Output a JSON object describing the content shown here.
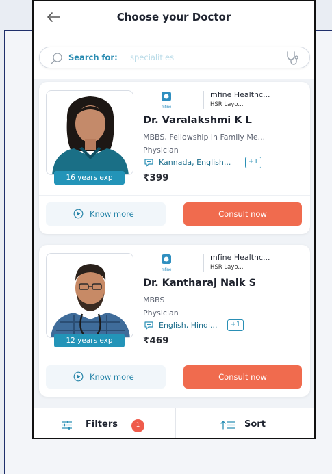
{
  "header": {
    "title": "Choose your Doctor"
  },
  "search": {
    "prefix": "Search for:",
    "placeholder": "specialities"
  },
  "doctors": [
    {
      "clinic_name": "mfine Healthc...",
      "clinic_location": "HSR Layo...",
      "clinic_logo_text": "mfine",
      "name": "Dr.  Varalakshmi K L",
      "qualification": "MBBS, Fellowship in Family Me...",
      "specialty": "Physician",
      "languages": "Kannada, English...",
      "languages_more": "+1",
      "price": "₹399",
      "experience": "16 years exp",
      "know_more": "Know more",
      "consult": "Consult now"
    },
    {
      "clinic_name": "mfine Healthc...",
      "clinic_location": "HSR Layo...",
      "clinic_logo_text": "mfine",
      "name": "Dr.  Kantharaj Naik S",
      "qualification": "MBBS",
      "specialty": "Physician",
      "languages": "English, Hindi...",
      "languages_more": "+1",
      "price": "₹469",
      "experience": "12 years exp",
      "know_more": "Know more",
      "consult": "Consult now"
    }
  ],
  "bottom_bar": {
    "filters_label": "Filters",
    "filters_count": "1",
    "sort_label": "Sort"
  },
  "colors": {
    "accent": "#2394b8",
    "cta": "#f06b4e",
    "badge": "#ef5b4b"
  }
}
